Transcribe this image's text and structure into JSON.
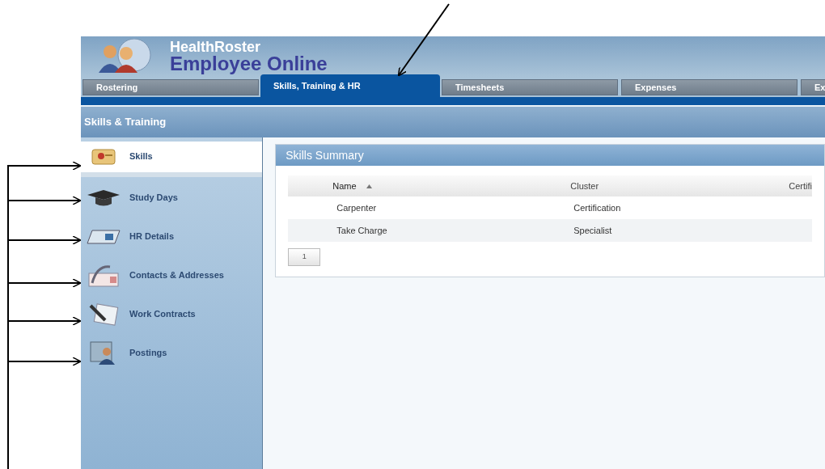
{
  "app": {
    "title": "HealthRoster",
    "subtitle": "Employee Online"
  },
  "tabs": [
    {
      "label": "Rostering",
      "selected": false
    },
    {
      "label": "Skills, Training & HR",
      "selected": true
    },
    {
      "label": "Timesheets",
      "selected": false
    },
    {
      "label": "Expenses",
      "selected": false
    },
    {
      "label": "Ex",
      "selected": false
    }
  ],
  "section_bar": {
    "title": "Skills & Training"
  },
  "sidebar": {
    "items": [
      {
        "label": "Skills",
        "selected": true
      },
      {
        "label": "Study Days",
        "selected": false
      },
      {
        "label": "HR Details",
        "selected": false
      },
      {
        "label": "Contacts & Addresses",
        "selected": false
      },
      {
        "label": "Work Contracts",
        "selected": false
      },
      {
        "label": "Postings",
        "selected": false
      }
    ]
  },
  "panel": {
    "title": "Skills Summary",
    "table": {
      "columns": [
        {
          "label": "Name",
          "sorted": true
        },
        {
          "label": "Cluster",
          "sorted": false
        },
        {
          "label": "Certifi",
          "sorted": false
        }
      ],
      "rows": [
        [
          "Carpenter",
          "Certification",
          ""
        ],
        [
          "Take Charge",
          "Specialist",
          ""
        ]
      ]
    },
    "pager": [
      "1"
    ]
  }
}
